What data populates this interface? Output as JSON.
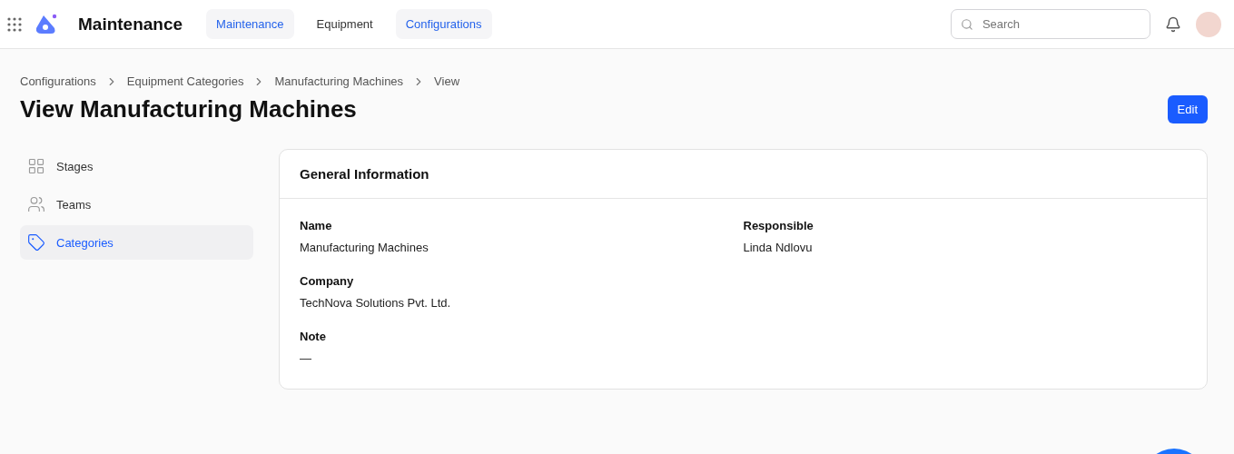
{
  "app": {
    "title": "Maintenance"
  },
  "nav_tabs": [
    {
      "label": "Maintenance",
      "selected": true
    },
    {
      "label": "Equipment",
      "selected": false
    },
    {
      "label": "Configurations",
      "selected": true
    }
  ],
  "search": {
    "placeholder": "Search"
  },
  "breadcrumbs": [
    "Configurations",
    "Equipment Categories",
    "Manufacturing Machines",
    "View"
  ],
  "page_title": "View Manufacturing Machines",
  "edit_button": "Edit",
  "sidebar": {
    "items": [
      {
        "label": "Stages",
        "kind": "grid",
        "selected": false
      },
      {
        "label": "Teams",
        "kind": "people",
        "selected": false
      },
      {
        "label": "Categories",
        "kind": "tag",
        "selected": true
      }
    ]
  },
  "card": {
    "title": "General Information",
    "rows": [
      [
        {
          "label": "Name",
          "value": "Manufacturing Machines"
        },
        {
          "label": "Responsible",
          "value": "Linda Ndlovu"
        }
      ],
      [
        {
          "label": "Company",
          "value": "TechNova Solutions Pvt. Ltd."
        }
      ],
      [
        {
          "label": "Note",
          "value": "—"
        }
      ]
    ]
  }
}
